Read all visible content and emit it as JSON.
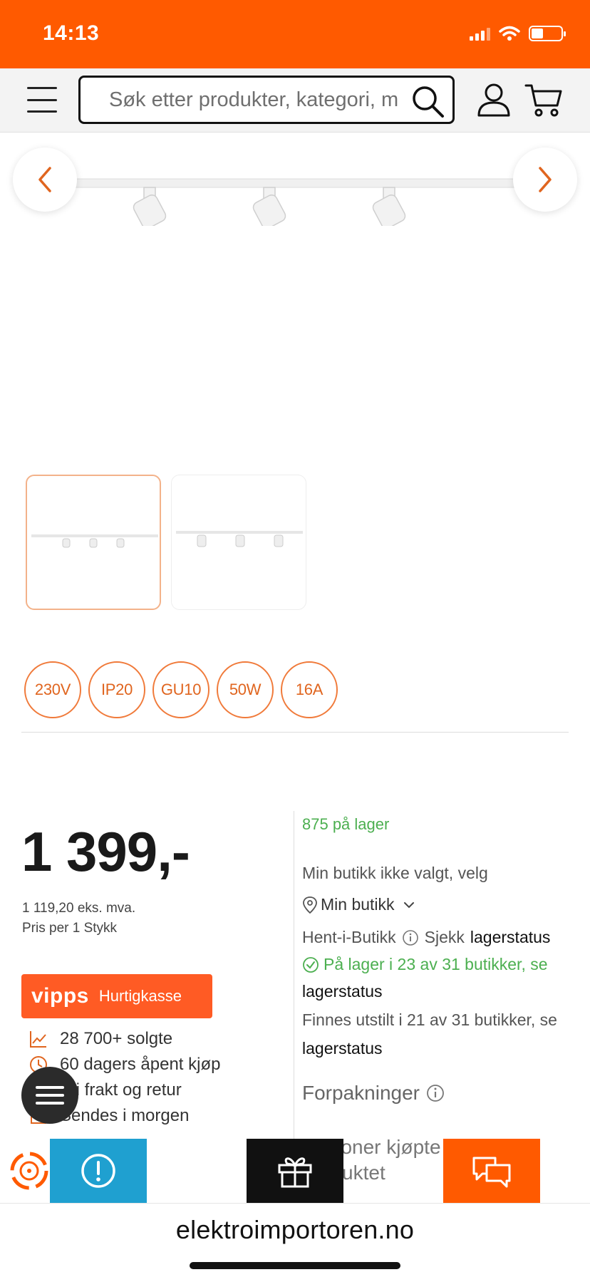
{
  "status_bar": {
    "time": "14:13"
  },
  "header": {
    "search_placeholder": "Søk etter produkter, kategori, m"
  },
  "product": {
    "specs": [
      "230V",
      "IP20",
      "GU10",
      "50W",
      "16A"
    ],
    "price": "1 399,-",
    "price_ex_vat": "1 119,20 eks. mva.",
    "price_unit": "Pris per 1 Stykk",
    "vipps_logo": "vipps",
    "vipps_label": "Hurtigkasse",
    "usps": [
      {
        "icon": "trend-chart-icon",
        "text": "28 700+ solgte"
      },
      {
        "icon": "clock-icon",
        "text": "60 dagers åpent kjøp"
      },
      {
        "icon": "truck-icon",
        "text": "Fri frakt og retur"
      },
      {
        "icon": "package-icon",
        "text": "Sendes i morgen"
      }
    ]
  },
  "stock": {
    "count": "875 på lager",
    "store_not_set": "Min butikk ikke valgt, velg",
    "my_store": "Min butikk",
    "pickup_label": "Hent-i-Butikk",
    "check_label": "Sjekk",
    "check_link": "lagerstatus",
    "in_stores": "På lager i 23 av 31 butikker, se",
    "in_stores_link": "lagerstatus",
    "displayed": "Finnes utstilt i 21 av 31 butikker, se",
    "displayed_link": "lagerstatus",
    "packaging": "Forpakninger",
    "others_bought": "personer kjøpte dette produktet"
  },
  "footer": {
    "url": "elektroimportoren.no"
  },
  "colors": {
    "brand": "#ff5a00",
    "stock_green": "#4caf50",
    "vipps": "#ff5b24"
  }
}
